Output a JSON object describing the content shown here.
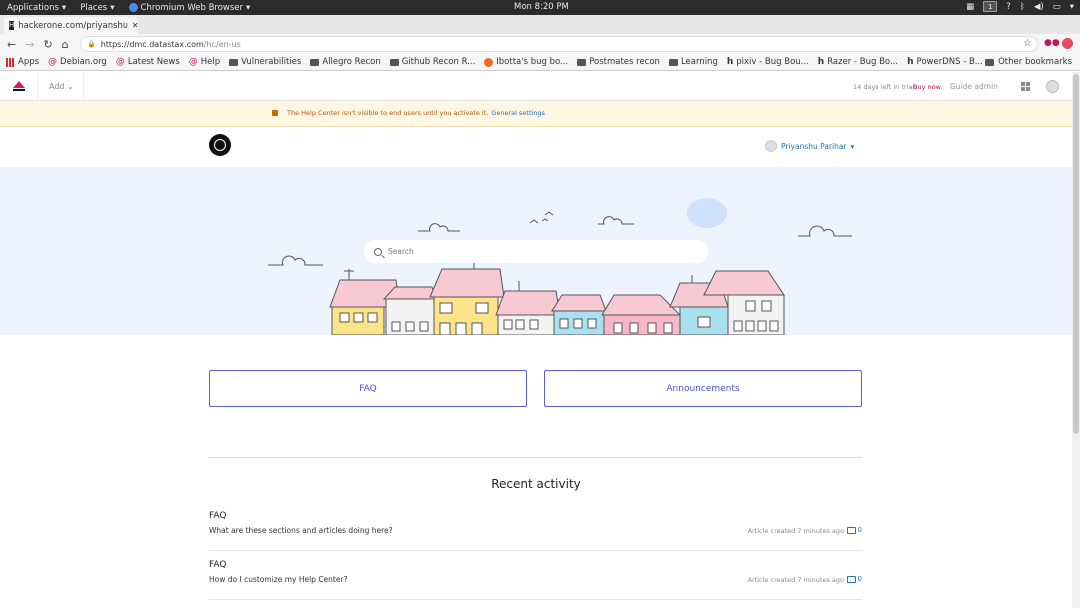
{
  "topbar": {
    "applications": "Applications",
    "places": "Places",
    "browser": "Chromium Web Browser",
    "clock": "Mon 8:20 PM",
    "workspace": "1"
  },
  "browser": {
    "tab_title": "hackerone.com/priyanshᴜ",
    "tab_favicon": "H",
    "url_host": "https://dmc.datastax.com",
    "url_path": "/hc/en-us",
    "more_label": "»",
    "bookmarks": [
      {
        "label": "Apps",
        "icon": "apps-grid-icon"
      },
      {
        "label": "Debian.org",
        "icon": "debian-icon"
      },
      {
        "label": "Latest News",
        "icon": "debian-icon"
      },
      {
        "label": "Help",
        "icon": "debian-icon"
      },
      {
        "label": "Vulnerabilities",
        "icon": "folder-icon"
      },
      {
        "label": "Allegro Recon",
        "icon": "folder-icon"
      },
      {
        "label": "Github Recon R...",
        "icon": "folder-icon"
      },
      {
        "label": "Ibotta's bug bo...",
        "icon": "bugcrowd-icon"
      },
      {
        "label": "Postmates recon",
        "icon": "folder-icon"
      },
      {
        "label": "Learning",
        "icon": "folder-icon"
      },
      {
        "label": "pixiv - Bug Bou...",
        "icon": "hackerone-icon"
      },
      {
        "label": "Razer - Bug Bo...",
        "icon": "hackerone-icon"
      },
      {
        "label": "PowerDNS - B...",
        "icon": "hackerone-icon"
      }
    ],
    "other_bookmarks": "Other bookmarks"
  },
  "zendesk": {
    "add_label": "Add",
    "trial_text": "14 days left in trial",
    "buy_now": "Buy now",
    "guide_admin": "Guide admin"
  },
  "banner": {
    "text": "The Help Center isn't visible to end users until you activate it.",
    "link": "General settings"
  },
  "helpcenter": {
    "user_name": "Priyanshu Parihar",
    "search_placeholder": "Search",
    "categories": [
      "FAQ",
      "Announcements"
    ],
    "recent_activity_title": "Recent activity",
    "activities": [
      {
        "section": "FAQ",
        "article": "What are these sections and articles doing here?",
        "meta": "Article created 7 minutes ago",
        "comments": "0"
      },
      {
        "section": "FAQ",
        "article": "How do I customize my Help Center?",
        "meta": "Article created 7 minutes ago",
        "comments": "0"
      }
    ]
  },
  "colors": {
    "accent": "#1f73b7",
    "category_border": "#5c5fd6",
    "hero_bg": "#eef4ff",
    "banner_bg": "#fdf7e3",
    "buy_now": "#c2185b"
  }
}
